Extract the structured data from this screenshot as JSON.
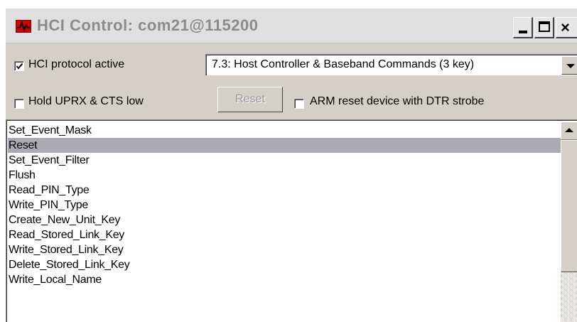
{
  "window": {
    "title": "HCI Control: com21@115200",
    "close_glyph": "×"
  },
  "options": {
    "protocol_active": {
      "label": "HCI protocol active",
      "checked": true
    },
    "command_group": {
      "selected": "7.3: Host Controller & Baseband Commands (3 key)"
    },
    "hold_uprx": {
      "label": "Hold UPRX & CTS low",
      "checked": false
    },
    "reset_button": {
      "label": "Reset",
      "enabled": false
    },
    "arm_reset": {
      "label": "ARM reset device with DTR strobe",
      "checked": false
    }
  },
  "commands": {
    "items": [
      "Set_Event_Mask",
      "Reset",
      "Set_Event_Filter",
      "Flush",
      "Read_PIN_Type",
      "Write_PIN_Type",
      "Create_New_Unit_Key",
      "Read_Stored_Link_Key",
      "Write_Stored_Link_Key",
      "Delete_Stored_Link_Key",
      "Write_Local_Name"
    ],
    "selected_index": 1
  },
  "icons": {
    "app": "waveform-icon",
    "minimize": "minimize-icon",
    "maximize": "maximize-icon",
    "close": "close-icon",
    "dropdown": "chevron-down-icon",
    "scroll_up": "arrow-up-icon",
    "check": "checkmark-icon"
  },
  "colors": {
    "selection": "#a9aab6",
    "app_icon": "#d40000",
    "title_text": "#8b8b8b",
    "face": "#d4d0c8"
  }
}
